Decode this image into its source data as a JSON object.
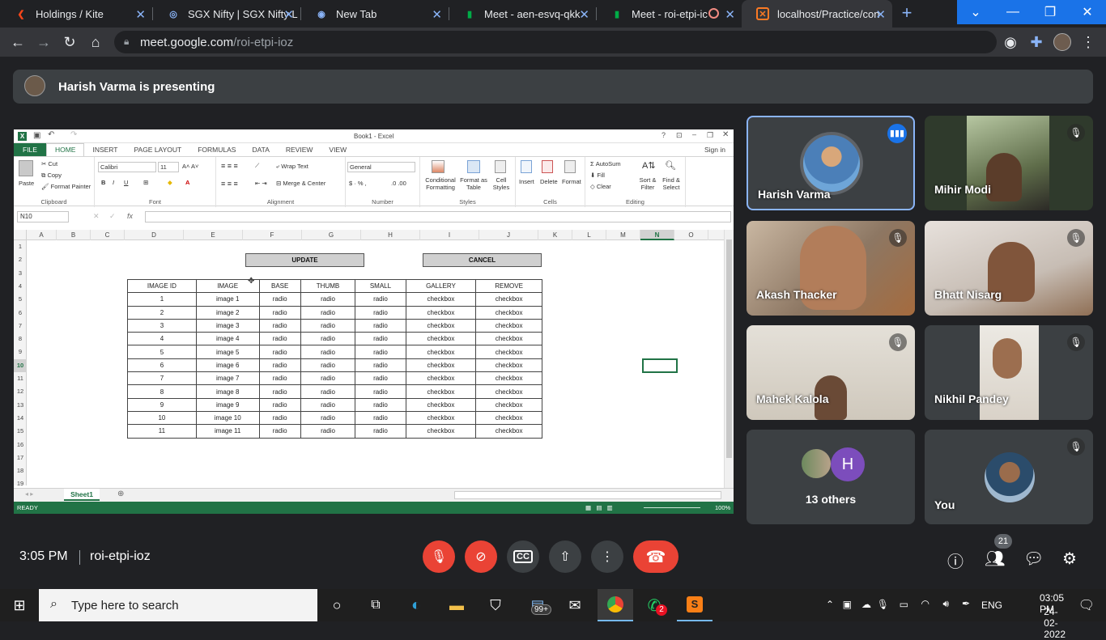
{
  "browser": {
    "tabs": [
      {
        "title": "Holdings / Kite",
        "icon": "kite-icon",
        "color": "#f6461a"
      },
      {
        "title": "SGX Nifty | SGX Nifty L",
        "icon": "globe-icon",
        "color": "#8ab4f8"
      },
      {
        "title": "New Tab",
        "icon": "chrome-icon",
        "color": "#8ab4f8"
      },
      {
        "title": "Meet - aen-esvq-qkk",
        "icon": "meet-icon",
        "color": "#00ac47"
      },
      {
        "title": "Meet - roi-etpi-ic",
        "icon": "meet-icon",
        "color": "#00ac47"
      },
      {
        "title": "localhost/Practice/con",
        "icon": "xampp-icon",
        "color": "#fb7a24"
      }
    ],
    "url_host": "meet.google.com",
    "url_path": "/roi-etpi-ioz"
  },
  "presenting": {
    "text": "Harish Varma is presenting"
  },
  "excel": {
    "window_title": "Book1 - Excel",
    "sign_in": "Sign in",
    "menu": [
      "FILE",
      "HOME",
      "INSERT",
      "PAGE LAYOUT",
      "FORMULAS",
      "DATA",
      "REVIEW",
      "VIEW"
    ],
    "ribbon": {
      "paste": "Paste",
      "cut": "Cut",
      "copy": "Copy",
      "format_painter": "Format Painter",
      "clipboard": "Clipboard",
      "font_name": "Calibri",
      "font_size": "11",
      "font": "Font",
      "wrap_text": "Wrap Text",
      "merge_center": "Merge & Center",
      "alignment": "Alignment",
      "number_format": "General",
      "number": "Number",
      "conditional_formatting": "Conditional Formatting",
      "format_as_table": "Format as Table",
      "cell_styles": "Cell Styles",
      "styles": "Styles",
      "insert": "Insert",
      "delete": "Delete",
      "format": "Format",
      "cells": "Cells",
      "autosum": "AutoSum",
      "fill": "Fill",
      "clear": "Clear",
      "sort_filter": "Sort & Filter",
      "find_select": "Find & Select",
      "editing": "Editing"
    },
    "name_box": "N10",
    "fx": "fx",
    "columns": [
      "A",
      "B",
      "C",
      "D",
      "E",
      "F",
      "G",
      "H",
      "I",
      "J",
      "K",
      "L",
      "M",
      "N",
      "O"
    ],
    "rows": [
      "1",
      "2",
      "3",
      "4",
      "5",
      "6",
      "7",
      "8",
      "9",
      "10",
      "11",
      "12",
      "13",
      "14",
      "15",
      "16",
      "17",
      "18",
      "19"
    ],
    "selected_column": "N",
    "selected_row": "10",
    "update_button": "UPDATE",
    "cancel_button": "CANCEL",
    "table_headers": [
      "IMAGE ID",
      "IMAGE",
      "BASE",
      "THUMB",
      "SMALL",
      "GALLERY",
      "REMOVE"
    ],
    "table_rows": [
      [
        "1",
        "image 1",
        "radio",
        "radio",
        "radio",
        "checkbox",
        "checkbox"
      ],
      [
        "2",
        "image 2",
        "radio",
        "radio",
        "radio",
        "checkbox",
        "checkbox"
      ],
      [
        "3",
        "image 3",
        "radio",
        "radio",
        "radio",
        "checkbox",
        "checkbox"
      ],
      [
        "4",
        "image 4",
        "radio",
        "radio",
        "radio",
        "checkbox",
        "checkbox"
      ],
      [
        "5",
        "image 5",
        "radio",
        "radio",
        "radio",
        "checkbox",
        "checkbox"
      ],
      [
        "6",
        "image 6",
        "radio",
        "radio",
        "radio",
        "checkbox",
        "checkbox"
      ],
      [
        "7",
        "image 7",
        "radio",
        "radio",
        "radio",
        "checkbox",
        "checkbox"
      ],
      [
        "8",
        "image 8",
        "radio",
        "radio",
        "radio",
        "checkbox",
        "checkbox"
      ],
      [
        "9",
        "image 9",
        "radio",
        "radio",
        "radio",
        "checkbox",
        "checkbox"
      ],
      [
        "10",
        "image 10",
        "radio",
        "radio",
        "radio",
        "checkbox",
        "checkbox"
      ],
      [
        "11",
        "image 11",
        "radio",
        "radio",
        "radio",
        "checkbox",
        "checkbox"
      ]
    ],
    "sheet_tab": "Sheet1",
    "status": "READY",
    "zoom": "100%"
  },
  "participants": [
    {
      "name": "Harish Varma",
      "speaking": true
    },
    {
      "name": "Mihir Modi",
      "muted": true
    },
    {
      "name": "Akash Thacker",
      "muted": true
    },
    {
      "name": "Bhatt Nisarg",
      "muted": true
    },
    {
      "name": "Mahek Kalola",
      "muted": true
    },
    {
      "name": "Nikhil Pandey",
      "muted": true
    },
    {
      "name": "13 others",
      "avatar_letter": "H"
    },
    {
      "name": "You",
      "muted": true
    }
  ],
  "meeting": {
    "time": "3:05 PM",
    "code": "roi-etpi-ioz",
    "people_count": "21"
  },
  "taskbar": {
    "search_placeholder": "Type here to search",
    "mail_badge": "99+",
    "whatsapp_badge": "2",
    "language": "ENG",
    "clock_time": "03:05 PM",
    "clock_date": "24-02-2022"
  }
}
